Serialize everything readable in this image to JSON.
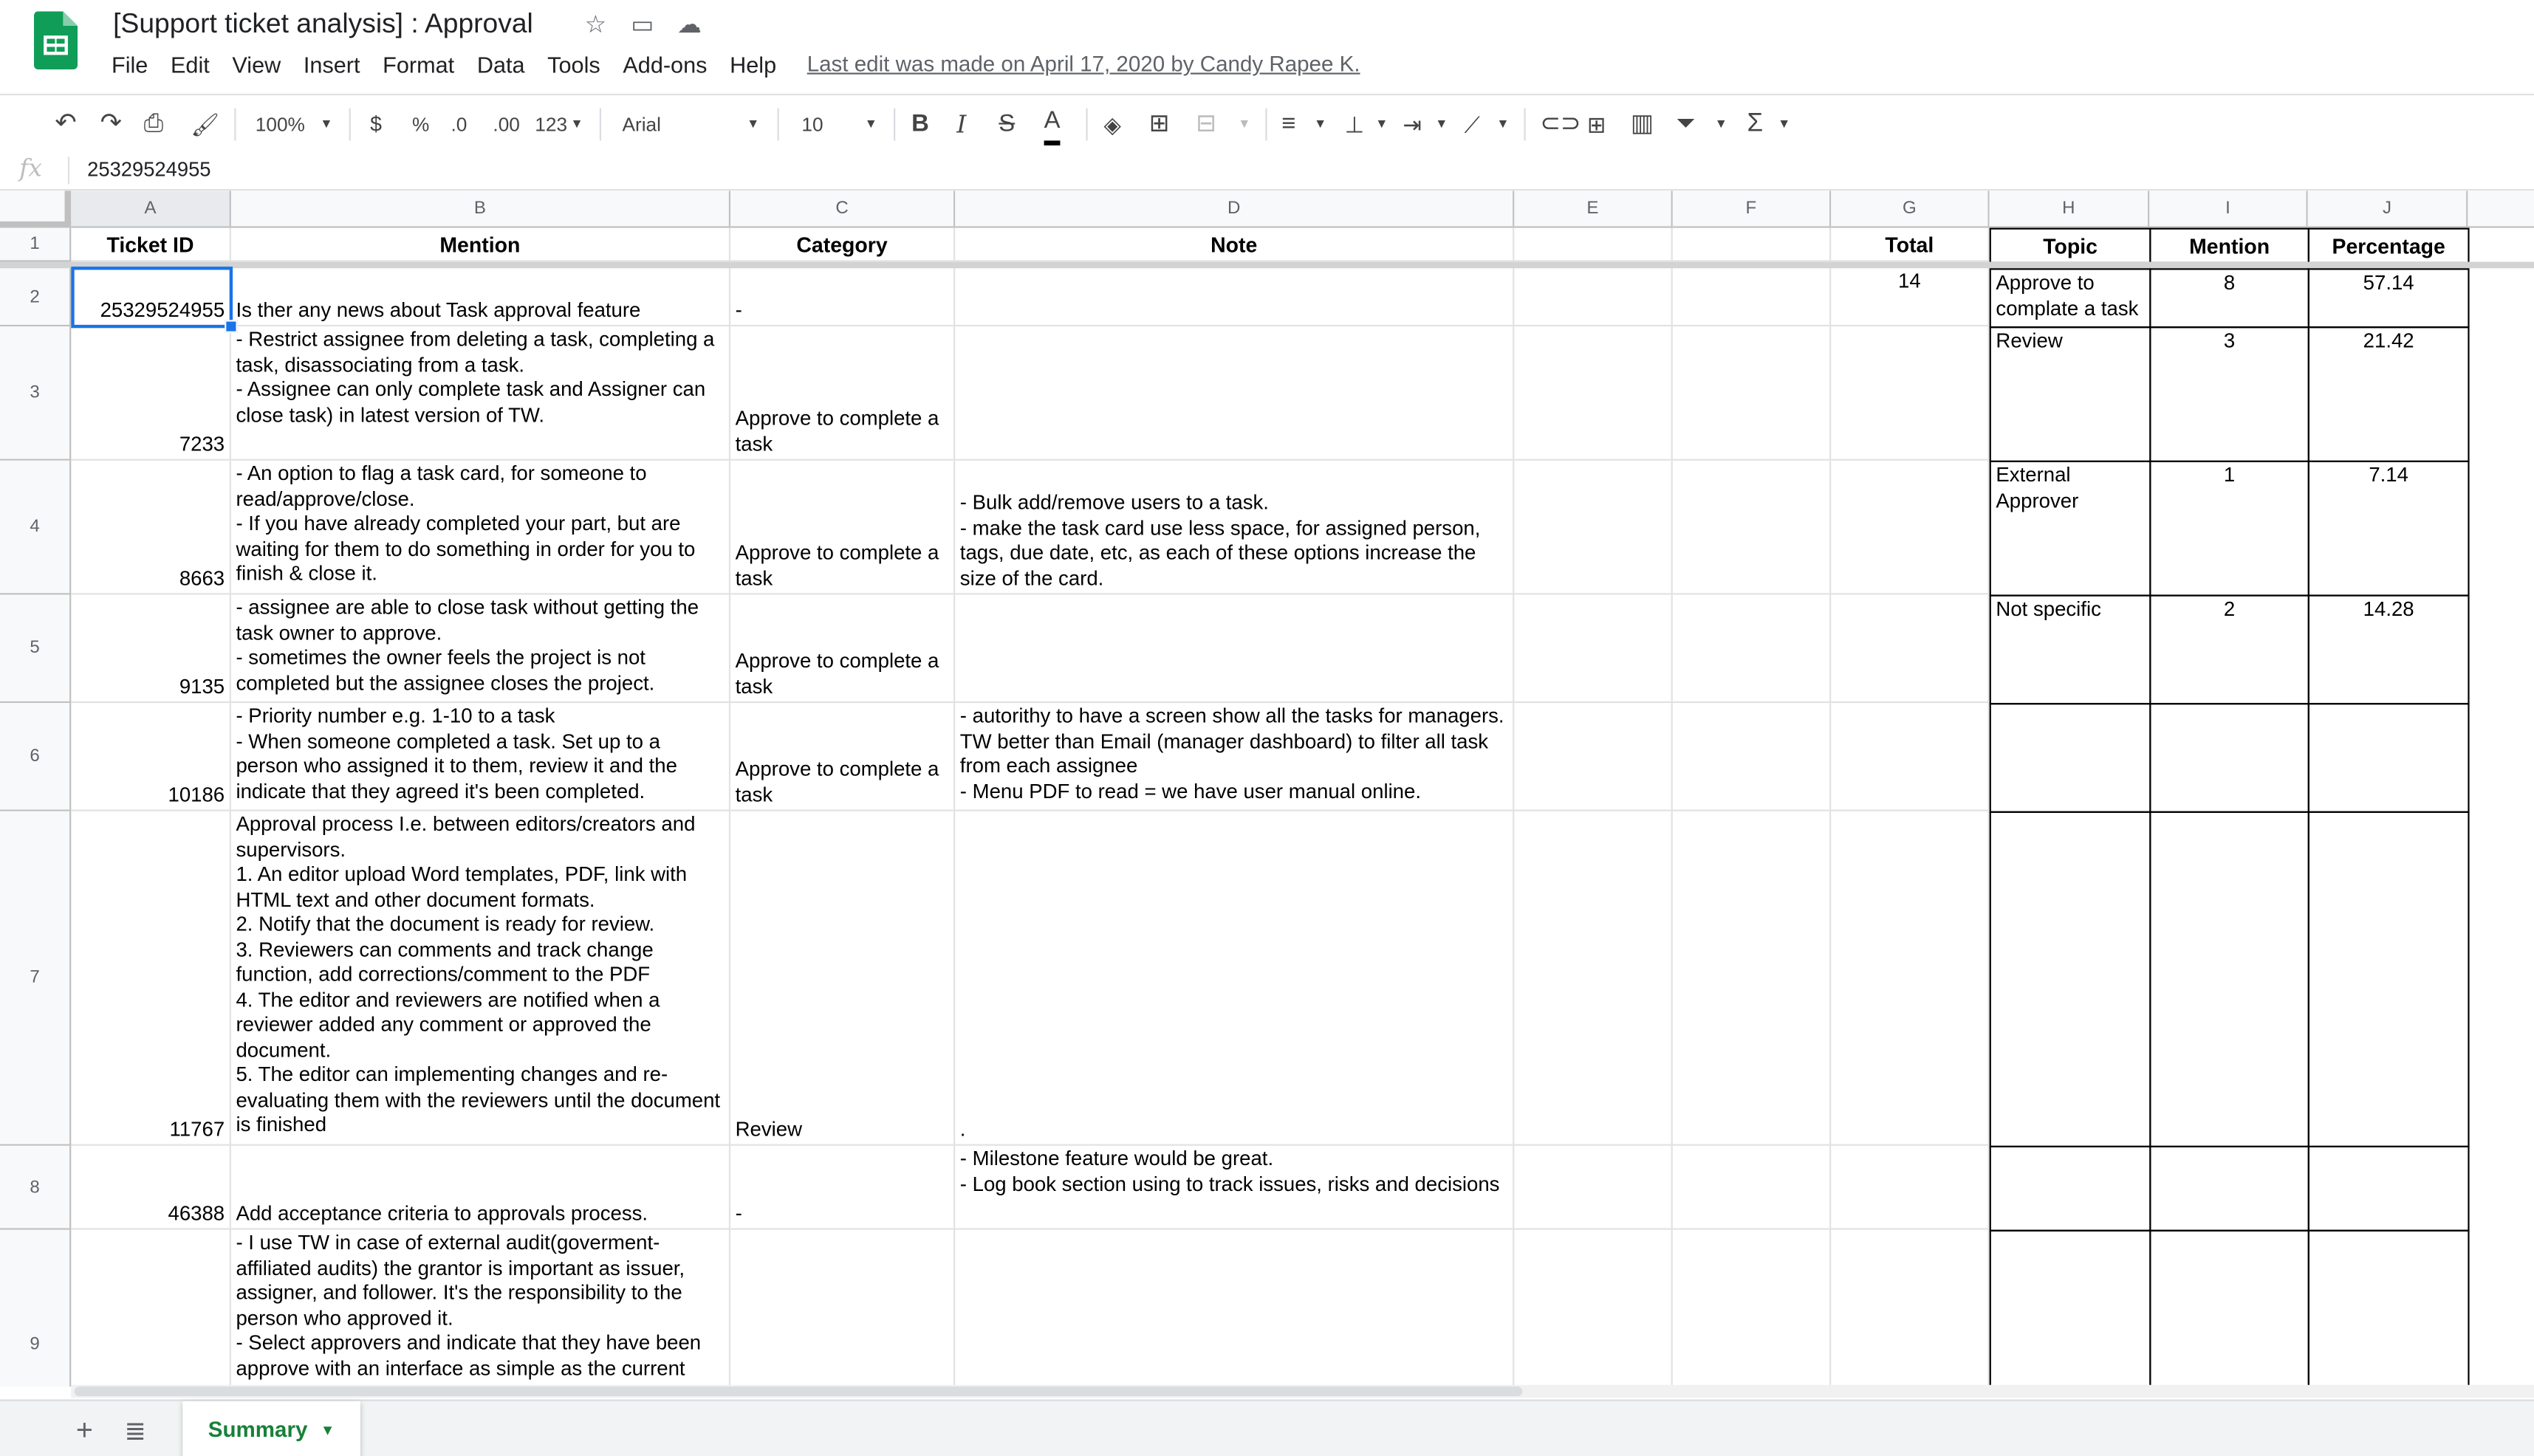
{
  "header": {
    "title": "[Support ticket analysis] : Approval",
    "menus": [
      "File",
      "Edit",
      "View",
      "Insert",
      "Format",
      "Data",
      "Tools",
      "Add-ons",
      "Help"
    ],
    "last_edit": "Last edit was made on April 17, 2020 by Candy Rapee K."
  },
  "toolbar": {
    "zoom": "100%",
    "currency": "$",
    "percent": "%",
    "decimal_decrease": ".0",
    "decimal_increase": ".00",
    "more_formats": "123",
    "font": "Arial",
    "font_size": "10"
  },
  "formula_bar": {
    "fx": "fx",
    "value": "25329524955"
  },
  "columns": [
    "A",
    "B",
    "C",
    "D",
    "E",
    "F",
    "G",
    "H",
    "I",
    "J"
  ],
  "rows": [
    "1",
    "2",
    "3",
    "4",
    "5",
    "6",
    "7",
    "8",
    "9"
  ],
  "table_headers": {
    "a": "Ticket ID",
    "b": "Mention",
    "c": "Category",
    "d": "Note",
    "g": "Total",
    "h": "Topic",
    "i": "Mention",
    "j": "Percentage"
  },
  "table_rows": [
    {
      "id": "25329524955",
      "mention": "Is ther any news about Task approval feature",
      "category": "-",
      "note": ""
    },
    {
      "id": "7233",
      "mention": "- Restrict assignee from deleting a task, completing a task, disassociating from a task.\n- Assignee can only complete task and Assigner can close task) in latest version of TW.",
      "category": "Approve to complete a task",
      "note": ""
    },
    {
      "id": "8663",
      "mention": "- An option to flag a task card, for someone to read/approve/close.\n- If you have already completed your part, but are waiting for them to do something in order for you to finish & close it.",
      "category": "Approve to complete a task",
      "note": "- Bulk add/remove users to a task.\n- make the task card use less space, for assigned person, tags, due date, etc, as each of these options increase the size of the card."
    },
    {
      "id": "9135",
      "mention": "- assignee are able to close task without getting the task owner to approve.\n- sometimes the owner feels the project is not completed but the assignee closes the project.",
      "category": "Approve to complete a task",
      "note": ""
    },
    {
      "id": "10186",
      "mention": "- Priority number e.g. 1-10 to a task\n- When someone completed a task. Set up to a person who assigned it to them, review it and the indicate that they agreed it's been completed.",
      "category": "Approve to complete a task",
      "note": "- autorithy to have a screen show all the tasks for managers. TW better than Email (manager dashboard) to filter all task from each assignee\n- Menu PDF to read = we have user manual online."
    },
    {
      "id": "11767",
      "mention": "Approval process I.e. between editors/creators and supervisors.\n1. An editor upload Word templates, PDF, link with HTML text and other document formats.\n2. Notify that the document is ready for review.\n3. Reviewers can comments and track change function, add corrections/comment to the PDF\n4. The editor and reviewers are notified when a reviewer added any comment or approved the document.\n5. The editor can implementing changes and re-evaluating them with the reviewers until the document is finished",
      "category": "Review",
      "note": "."
    },
    {
      "id": "46388",
      "mention": "Add acceptance criteria to approvals process.",
      "category": "-",
      "note": "- Milestone feature would be great.\n- Log book section using to track issues, risks and decisions"
    },
    {
      "id": "",
      "mention": "- I use TW in case of external audit(goverment-affiliated audits) the grantor is important as issuer, assigner, and follower. It's the responsibility to the person who approved it.\n- Select approvers and indicate that they have been approve with an interface as simple as the current",
      "category": "",
      "note": ""
    }
  ],
  "summary": {
    "total": "14",
    "topics": [
      {
        "topic": "Approve to complate a task",
        "mention": "8",
        "percentage": "57.14"
      },
      {
        "topic": "Review",
        "mention": "3",
        "percentage": "21.42"
      },
      {
        "topic": "External Approver",
        "mention": "1",
        "percentage": "7.14"
      },
      {
        "topic": "Not specific",
        "mention": "2",
        "percentage": "14.28"
      }
    ]
  },
  "sheets": {
    "active": "Summary"
  },
  "colors": {
    "sheets_green": "#188038",
    "selection_blue": "#1a73e8"
  }
}
